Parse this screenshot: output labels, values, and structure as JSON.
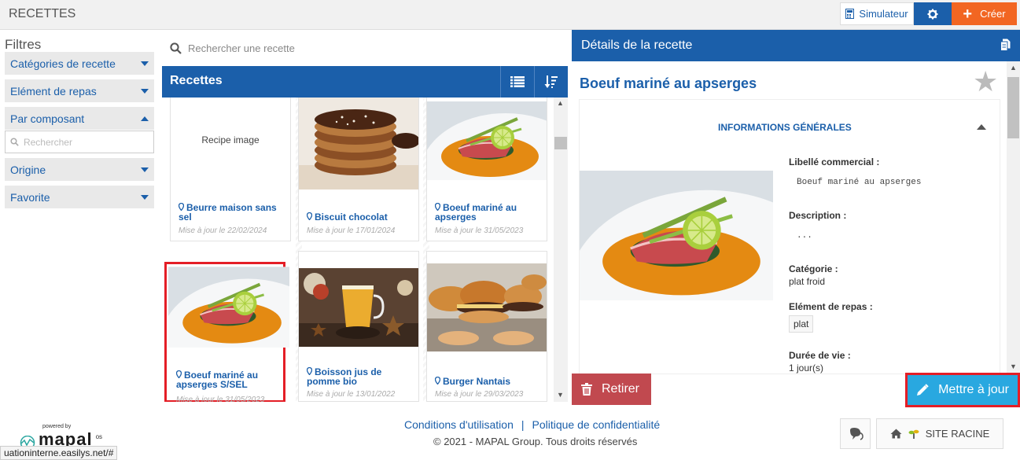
{
  "app_title": "RECETTES",
  "topbar": {
    "simulator_label": "Simulateur",
    "create_label": "Créer"
  },
  "filters": {
    "title": "Filtres",
    "items": [
      {
        "label": "Catégories de recette",
        "expanded": false
      },
      {
        "label": "Elément de repas",
        "expanded": false
      },
      {
        "label": "Par composant",
        "expanded": true
      },
      {
        "label": "Origine",
        "expanded": false
      },
      {
        "label": "Favorite",
        "expanded": false
      }
    ],
    "search_placeholder": "Rechercher"
  },
  "recipe_search": {
    "placeholder": "Rechercher une recette"
  },
  "recipes_header": {
    "title": "Recettes"
  },
  "recipes": [
    {
      "name": "Beurre maison sans sel",
      "date": "Mise à jour le 22/02/2024",
      "image": "placeholder",
      "image_label": "Recipe image"
    },
    {
      "name": "Biscuit chocolat",
      "date": "Mise à jour le 17/01/2024",
      "image": "biscuit"
    },
    {
      "name": "Boeuf mariné au apserges",
      "date": "Mise à jour le 31/05/2023",
      "image": "tuna"
    },
    {
      "name": "Boeuf mariné au apserges S/SEL",
      "date": "Mise à jour le 31/05/2023",
      "image": "tuna",
      "selected": true
    },
    {
      "name": "Boisson jus de pomme bio",
      "date": "Mise à jour le 13/01/2022",
      "image": "drink"
    },
    {
      "name": "Burger Nantais",
      "date": "Mise à jour le 29/03/2023",
      "image": "burger"
    }
  ],
  "details": {
    "header": "Détails de la recette",
    "title": "Boeuf mariné au apserges",
    "section_title": "INFORMATIONS GÉNÉRALES",
    "fields": {
      "commercial_label": "Libellé commercial :",
      "commercial_value": "Boeuf mariné au apserges",
      "description_label": "Description :",
      "description_value": "...",
      "category_label": "Catégorie :",
      "category_value": "plat froid",
      "meal_element_label": "Elément de repas :",
      "meal_element_value": "plat",
      "shelf_life_label": "Durée de vie :",
      "shelf_life_value": "1 jour(s)"
    },
    "remove_label": "Retirer",
    "update_label": "Mettre à jour"
  },
  "footer": {
    "terms": "Conditions d'utilisation",
    "separator": "|",
    "privacy": "Politique de confidentialité",
    "copyright": "© 2021 - MAPAL Group. Tous droits réservés",
    "powered_by": "powered by",
    "brand": "mapal",
    "brand_suffix": "os",
    "site_label": "SITE RACINE"
  },
  "status_url": "uationinterne.easilys.net/#",
  "colors": {
    "primary": "#1b5faa",
    "accent_orange": "#f26622",
    "danger": "#c1494f",
    "update": "#29a8e0",
    "highlight": "#e41e26"
  }
}
